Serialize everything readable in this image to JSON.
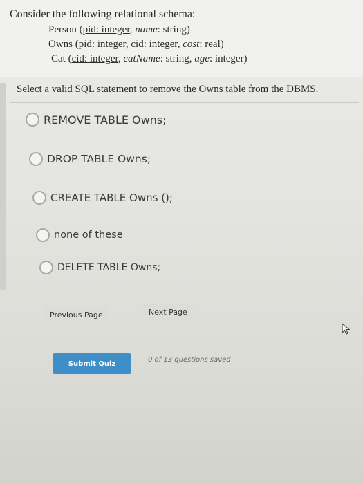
{
  "question": {
    "schema_title": "Consider the following relational schema:",
    "schema": {
      "person": {
        "name": "Person",
        "open": "(",
        "key": "pid: integer",
        "rest_sep": ", ",
        "attr": "name",
        "rest": ": string)"
      },
      "owns": {
        "name": "Owns",
        "open": "(",
        "key": "pid: integer, cid: integer",
        "rest_sep": ", ",
        "attr": "cost",
        "rest": ": real)"
      },
      "cat": {
        "name": "Cat",
        "open": "(",
        "key": "cid: integer",
        "rest_sep": ", ",
        "attr": "catName",
        "rest": ": string, ",
        "attr2": "age",
        "rest2": ": integer)"
      }
    },
    "prompt": "Select a valid SQL statement to remove the Owns table from the DBMS."
  },
  "options": [
    {
      "label": "REMOVE TABLE Owns;"
    },
    {
      "label": "DROP TABLE Owns;"
    },
    {
      "label": "CREATE TABLE Owns ();"
    },
    {
      "label": "none of these"
    },
    {
      "label": "DELETE TABLE Owns;"
    }
  ],
  "navigation": {
    "previous_label": "Previous Page",
    "next_label": "Next Page"
  },
  "footer": {
    "submit_label": "Submit Quiz",
    "status_text": "0 of 13 questions saved"
  },
  "colors": {
    "submit_button": "#3e8fc8"
  }
}
